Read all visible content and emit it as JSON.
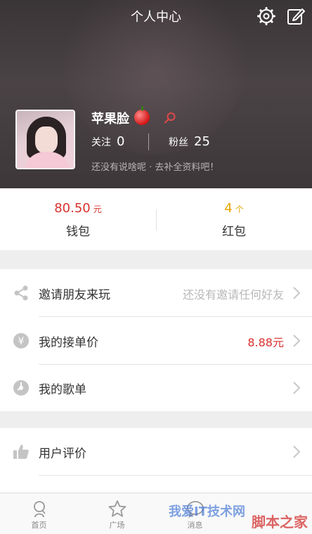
{
  "header": {
    "title": "个人中心",
    "settings_icon": "gear-icon",
    "edit_icon": "edit-icon"
  },
  "profile": {
    "name": "苹果脸",
    "follow_label": "关注",
    "follow_count": "0",
    "fans_label": "粉丝",
    "fans_count": "25",
    "signature": "还没有说啥呢 · 去补全资料吧！"
  },
  "wallet": {
    "amount": "80.50",
    "amount_unit": "元",
    "label": "钱包",
    "redpacket_count": "4",
    "redpacket_unit": "个",
    "redpacket_label": "红包",
    "accent_red": "#d8312f",
    "accent_yellow": "#e7a700"
  },
  "menu": {
    "invite_label": "邀请朋友来玩",
    "invite_value": "还没有邀请任何好友",
    "price_label": "我的接单价",
    "price_value": "8.88元",
    "playlist_label": "我的歌单",
    "review_label": "用户评价"
  },
  "tabs": {
    "home": "首页",
    "square": "广场",
    "messages": "消息"
  },
  "watermark": {
    "left": "我爱IT技术网",
    "right": "脚本之家"
  }
}
